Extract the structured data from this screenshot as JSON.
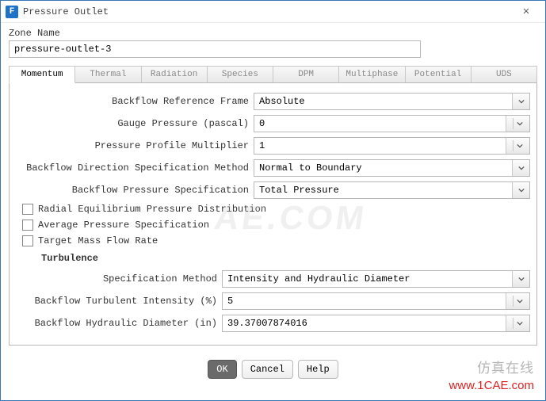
{
  "window": {
    "title": "Pressure Outlet",
    "logo_letter": "F",
    "close_glyph": "✕"
  },
  "zone": {
    "label": "Zone Name",
    "value": "pressure-outlet-3"
  },
  "tabs": [
    "Momentum",
    "Thermal",
    "Radiation",
    "Species",
    "DPM",
    "Multiphase",
    "Potential",
    "UDS"
  ],
  "active_tab_index": 0,
  "momentum": {
    "frame_label": "Backflow Reference Frame",
    "frame_value": "Absolute",
    "gauge_label": "Gauge Pressure (pascal)",
    "gauge_value": "0",
    "multiplier_label": "Pressure Profile Multiplier",
    "multiplier_value": "1",
    "direction_label": "Backflow Direction Specification Method",
    "direction_value": "Normal to Boundary",
    "pressure_spec_label": "Backflow Pressure Specification",
    "pressure_spec_value": "Total Pressure",
    "check1": "Radial Equilibrium Pressure Distribution",
    "check2": "Average Pressure Specification",
    "check3": "Target Mass Flow Rate",
    "turbulence_title": "Turbulence",
    "spec_method_label": "Specification Method",
    "spec_method_value": "Intensity and Hydraulic Diameter",
    "intensity_label": "Backflow Turbulent Intensity (%)",
    "intensity_value": "5",
    "diameter_label": "Backflow Hydraulic Diameter (in)",
    "diameter_value": "39.37007874016"
  },
  "buttons": {
    "ok": "OK",
    "cancel": "Cancel",
    "help": "Help"
  },
  "watermarks": {
    "w1": "AE.COM",
    "w2": "仿真在线",
    "w3": "www.1CAE.com"
  }
}
